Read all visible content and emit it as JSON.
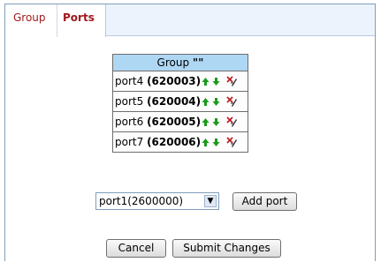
{
  "tabs": [
    {
      "label": "Group",
      "active": false
    },
    {
      "label": "Ports",
      "active": true
    }
  ],
  "table": {
    "header_prefix": "Group",
    "header_value": "\"\"",
    "rows": [
      {
        "port": "port4",
        "id": "(620003)"
      },
      {
        "port": "port5",
        "id": "(620004)"
      },
      {
        "port": "port6",
        "id": "(620005)"
      },
      {
        "port": "port7",
        "id": "(620006)"
      }
    ]
  },
  "add_port": {
    "selected_option": "port1(2600000)",
    "button_label": "Add port"
  },
  "actions": {
    "cancel_label": "Cancel",
    "submit_label": "Submit Changes"
  },
  "colors": {
    "tab_text": "#a0191d",
    "tabbar_bg": "#edf3fc",
    "header_bg": "#aed7f4",
    "arrow_green": "#1a9b1a",
    "delete_red": "#c0161b"
  }
}
